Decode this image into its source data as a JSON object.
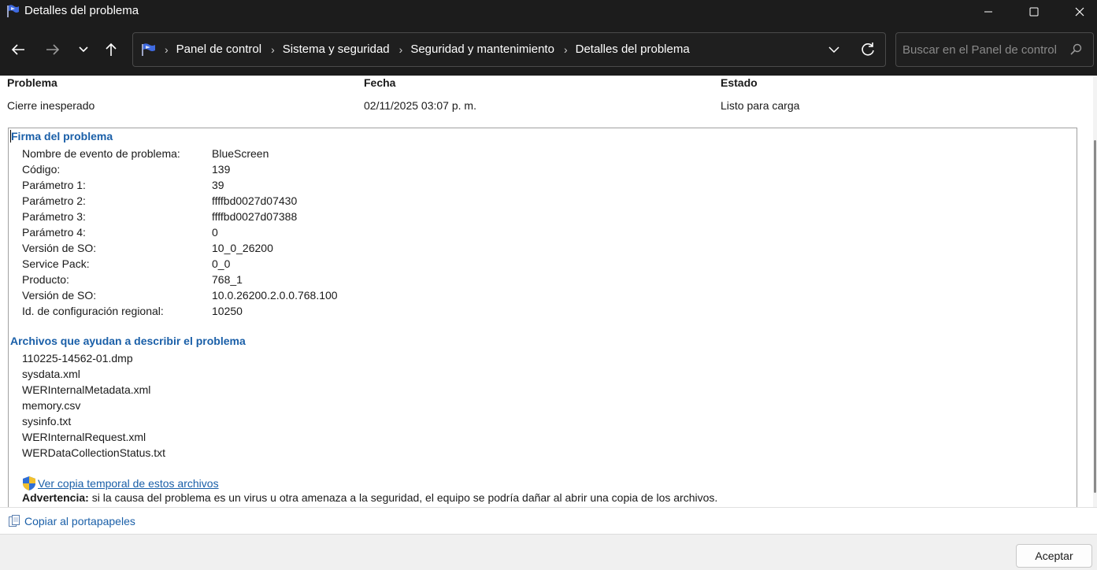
{
  "window": {
    "title": "Detalles del problema",
    "icons": {
      "app": "flag-icon",
      "minimize": "minimize-icon",
      "maximize": "maximize-icon",
      "close": "close-icon"
    }
  },
  "nav": {
    "icons": {
      "back": "arrow-left-icon",
      "forward": "arrow-right-icon",
      "recent": "chevron-down-icon",
      "up": "arrow-up-icon",
      "dropdown": "chevron-down-icon",
      "refresh": "refresh-icon"
    },
    "breadcrumbs": [
      "Panel de control",
      "Sistema y seguridad",
      "Seguridad y mantenimiento",
      "Detalles del problema"
    ],
    "search_placeholder": "Buscar en el Panel de control"
  },
  "summary": {
    "headers": {
      "problem": "Problema",
      "date": "Fecha",
      "status": "Estado"
    },
    "values": {
      "problem": "Cierre inesperado",
      "date": "02/11/2025 03:07 p. m.",
      "status": "Listo para carga"
    }
  },
  "signature": {
    "title": "Firma del problema",
    "rows": [
      {
        "key": "Nombre de evento de problema:",
        "value": "BlueScreen"
      },
      {
        "key": "Código:",
        "value": "139"
      },
      {
        "key": "Parámetro 1:",
        "value": "39"
      },
      {
        "key": "Parámetro 2:",
        "value": "ffffbd0027d07430"
      },
      {
        "key": "Parámetro 3:",
        "value": "ffffbd0027d07388"
      },
      {
        "key": "Parámetro 4:",
        "value": "0"
      },
      {
        "key": "Versión de SO:",
        "value": "10_0_26200"
      },
      {
        "key": "Service Pack:",
        "value": "0_0"
      },
      {
        "key": "Producto:",
        "value": "768_1"
      },
      {
        "key": "Versión de SO:",
        "value": "10.0.26200.2.0.0.768.100"
      },
      {
        "key": "Id. de configuración regional:",
        "value": "10250"
      }
    ]
  },
  "files": {
    "title": "Archivos que ayudan a describir el problema",
    "items": [
      "110225-14562-01.dmp",
      "sysdata.xml",
      "WERInternalMetadata.xml",
      "memory.csv",
      "sysinfo.txt",
      "WERInternalRequest.xml",
      "WERDataCollectionStatus.txt"
    ],
    "temp_copy_link": "Ver copia temporal de estos archivos",
    "warning_label": "Advertencia:",
    "warning_text": " si la causa del problema es un virus u otra amenaza a la seguridad, el equipo se podría dañar al abrir una copia de los archivos."
  },
  "copy_link": "Copiar al portapapeles",
  "accept_button": "Aceptar",
  "colors": {
    "titlebar": "#1c1c1c",
    "link": "#1a5fa8",
    "footer": "#f0f0f0"
  }
}
